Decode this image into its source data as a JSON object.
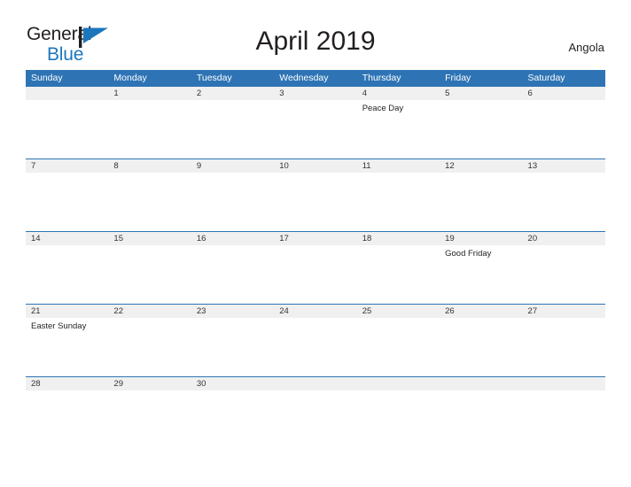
{
  "brand": {
    "word_one": "General",
    "word_two": "Blue",
    "flag_icon": "blue-triangle-flag-icon",
    "color_text": "#231f20",
    "color_blue": "#1c76bc"
  },
  "header": {
    "title": "April 2019",
    "locale": "Angola"
  },
  "theme": {
    "header_blue": "#2e74b5",
    "date_strip_gray": "#f0f0f0",
    "body_white": "#ffffff",
    "text_dark": "#231f20"
  },
  "calendar": {
    "weekdays": [
      "Sunday",
      "Monday",
      "Tuesday",
      "Wednesday",
      "Thursday",
      "Friday",
      "Saturday"
    ],
    "weeks": [
      {
        "days": [
          {
            "date": "",
            "event": ""
          },
          {
            "date": "1",
            "event": ""
          },
          {
            "date": "2",
            "event": ""
          },
          {
            "date": "3",
            "event": ""
          },
          {
            "date": "4",
            "event": "Peace Day"
          },
          {
            "date": "5",
            "event": ""
          },
          {
            "date": "6",
            "event": ""
          }
        ]
      },
      {
        "days": [
          {
            "date": "7",
            "event": ""
          },
          {
            "date": "8",
            "event": ""
          },
          {
            "date": "9",
            "event": ""
          },
          {
            "date": "10",
            "event": ""
          },
          {
            "date": "11",
            "event": ""
          },
          {
            "date": "12",
            "event": ""
          },
          {
            "date": "13",
            "event": ""
          }
        ]
      },
      {
        "days": [
          {
            "date": "14",
            "event": ""
          },
          {
            "date": "15",
            "event": ""
          },
          {
            "date": "16",
            "event": ""
          },
          {
            "date": "17",
            "event": ""
          },
          {
            "date": "18",
            "event": ""
          },
          {
            "date": "19",
            "event": "Good Friday"
          },
          {
            "date": "20",
            "event": ""
          }
        ]
      },
      {
        "days": [
          {
            "date": "21",
            "event": "Easter Sunday"
          },
          {
            "date": "22",
            "event": ""
          },
          {
            "date": "23",
            "event": ""
          },
          {
            "date": "24",
            "event": ""
          },
          {
            "date": "25",
            "event": ""
          },
          {
            "date": "26",
            "event": ""
          },
          {
            "date": "27",
            "event": ""
          }
        ]
      },
      {
        "short": true,
        "days": [
          {
            "date": "28",
            "event": ""
          },
          {
            "date": "29",
            "event": ""
          },
          {
            "date": "30",
            "event": ""
          },
          {
            "date": "",
            "event": ""
          },
          {
            "date": "",
            "event": ""
          },
          {
            "date": "",
            "event": ""
          },
          {
            "date": "",
            "event": ""
          }
        ]
      }
    ]
  }
}
